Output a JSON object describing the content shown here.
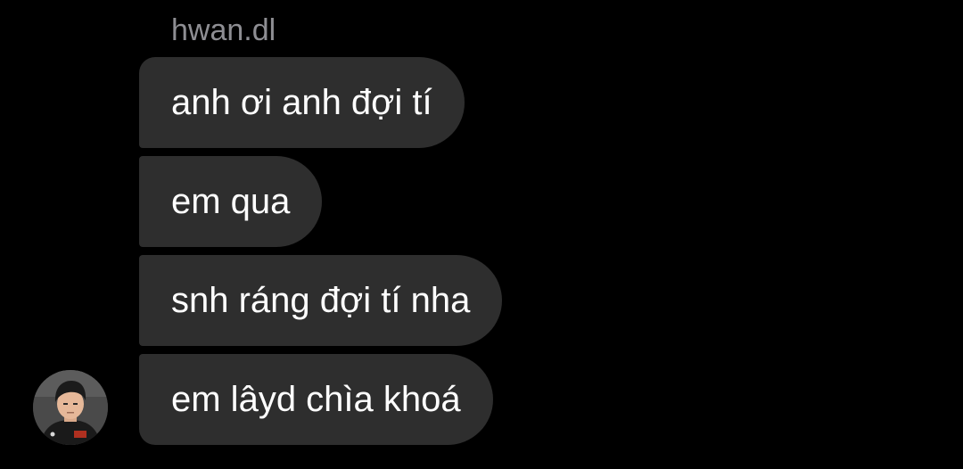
{
  "conversation": {
    "sender_name": "hwan.dl",
    "messages": [
      {
        "text": "anh ơi anh đợi tí"
      },
      {
        "text": "em qua"
      },
      {
        "text": "snh ráng đợi tí nha"
      },
      {
        "text": "em lâyd chìa khoá"
      }
    ]
  },
  "colors": {
    "background": "#000000",
    "bubble": "#2e2e2e",
    "message_text": "#ffffff",
    "sender_name": "#8e8e93"
  },
  "icons": {
    "avatar": "user-avatar-photo"
  }
}
